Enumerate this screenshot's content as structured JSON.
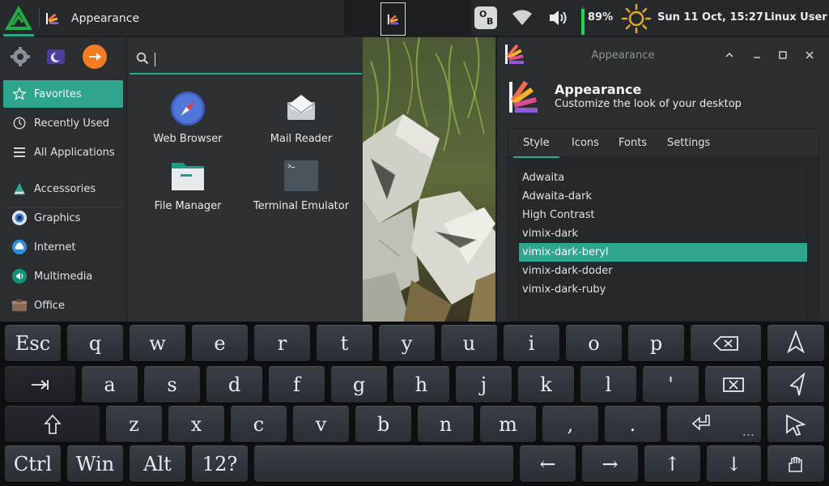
{
  "panel": {
    "active_window_title": "Appearance",
    "ob_icon_letters": [
      "O",
      "B"
    ],
    "battery_percent": 89,
    "battery_text": "89%",
    "clock": "Sun 11 Oct, 15:27",
    "user": "Linux User",
    "accent_color": "#2ea58c",
    "battery_color": "#21d64a"
  },
  "menu": {
    "search": {
      "value": "",
      "placeholder": ""
    },
    "top_icons": [
      "settings-icon",
      "lock-screen-icon",
      "logout-icon"
    ],
    "categories": [
      {
        "label": "Favorites",
        "icon": "star-icon",
        "selected": true
      },
      {
        "label": "Recently Used",
        "icon": "history-icon"
      },
      {
        "label": "All Applications",
        "icon": "list-icon"
      },
      {
        "label": "Accessories",
        "icon": "accessories-icon"
      },
      {
        "label": "Graphics",
        "icon": "graphics-icon"
      },
      {
        "label": "Internet",
        "icon": "internet-icon"
      },
      {
        "label": "Multimedia",
        "icon": "multimedia-icon"
      },
      {
        "label": "Office",
        "icon": "office-icon"
      }
    ],
    "apps": [
      {
        "label": "Web Browser",
        "icon": "compass-icon"
      },
      {
        "label": "Mail Reader",
        "icon": "mail-icon"
      },
      {
        "label": "File Manager",
        "icon": "folder-icon"
      },
      {
        "label": "Terminal Emulator",
        "icon": "terminal-icon"
      }
    ]
  },
  "appearance": {
    "window_title": "Appearance",
    "title": "Appearance",
    "subtitle": "Customize the look of your desktop",
    "tabs": [
      "Style",
      "Icons",
      "Fonts",
      "Settings"
    ],
    "active_tab": "Style",
    "themes": [
      "Adwaita",
      "Adwaita-dark",
      "High Contrast",
      "vimix-dark",
      "vimix-dark-beryl",
      "vimix-dark-doder",
      "vimix-dark-ruby"
    ],
    "selected_theme": "vimix-dark-beryl"
  },
  "keyboard": {
    "row1": [
      "Esc",
      "q",
      "w",
      "e",
      "r",
      "t",
      "y",
      "u",
      "i",
      "o",
      "p"
    ],
    "row2": [
      "a",
      "s",
      "d",
      "f",
      "g",
      "h",
      "j",
      "k",
      "l",
      "'"
    ],
    "row3": [
      "z",
      "x",
      "c",
      "v",
      "b",
      "n",
      "m",
      ",",
      "."
    ],
    "row3_extra": "...",
    "row4": [
      "Ctrl",
      "Win",
      "Alt",
      "12?"
    ],
    "arrows": [
      "←",
      "→",
      "↑",
      "↓"
    ]
  }
}
